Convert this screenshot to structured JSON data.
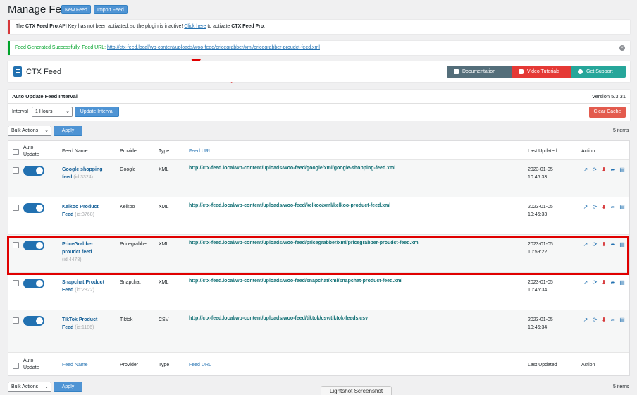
{
  "page": {
    "title": "Manage Feed",
    "new_feed": "New Feed",
    "import_feed": "Import Feed"
  },
  "notice_error": {
    "pre": "The ",
    "bold1": "CTX Feed Pro",
    "mid": " API Key has not been activated, so the plugin is inactive! ",
    "link": "Click here",
    "post": " to activate ",
    "bold2": "CTX Feed Pro",
    "end": "."
  },
  "notice_success": {
    "text": "Feed Generated Successfully. Feed URL: ",
    "url": "http://ctx-feed.local/wp-content/uploads/woo-feed/pricegrabber/xml/pricegrabber-proudct-feed.xml",
    "close": "×"
  },
  "header": {
    "app_title": "CTX Feed",
    "documentation": "Documentation",
    "video": "Video Tutorials",
    "support": "Get Support",
    "colors": {
      "documentation": "#546e7a",
      "video": "#e53935",
      "support": "#26a69a"
    }
  },
  "interval_panel": {
    "title": "Auto Update Feed Interval",
    "version": "Version 5.3.31",
    "interval_label": "Interval",
    "interval_value": "1 Hours",
    "update_button": "Update Interval",
    "clear_cache": "Clear Cache"
  },
  "bulk": {
    "label": "Bulk Actions",
    "apply": "Apply",
    "count": "5 items"
  },
  "columns": {
    "auto_update_1": "Auto",
    "auto_update_2": "Update",
    "feed_name": "Feed Name",
    "provider": "Provider",
    "type": "Type",
    "feed_url": "Feed URL",
    "last_updated": "Last Updated",
    "action": "Action"
  },
  "rows": [
    {
      "name1": "Google shopping",
      "name2": "feed",
      "id": "(id:3324)",
      "provider": "Google",
      "type": "XML",
      "url": "http://ctx-feed.local/wp-content/uploads/woo-feed/google/xml/google-shopping-feed.xml",
      "date": "2023-01-05",
      "time": "10:46:33",
      "auto_update": true
    },
    {
      "name1": "Kelkoo Product",
      "name2": "Feed",
      "id": "(id:3768)",
      "provider": "Kelkoo",
      "type": "XML",
      "url": "http://ctx-feed.local/wp-content/uploads/woo-feed/kelkoo/xml/kelkoo-product-feed.xml",
      "date": "2023-01-05",
      "time": "10:46:33",
      "auto_update": true
    },
    {
      "name1": "PriceGrabber",
      "name2": "proudct feed",
      "id": "(id:4478)",
      "provider": "Pricegrabber",
      "type": "XML",
      "url": "http://ctx-feed.local/wp-content/uploads/woo-feed/pricegrabber/xml/pricegrabber-proudct-feed.xml",
      "date": "2023-01-05",
      "time": "10:59:22",
      "auto_update": true
    },
    {
      "name1": "Snapchat Product",
      "name2": "Feed",
      "id": "(id:2822)",
      "provider": "Snapchat",
      "type": "XML",
      "url": "http://ctx-feed.local/wp-content/uploads/woo-feed/snapchat/xml/snapchat-product-feed.xml",
      "date": "2023-01-05",
      "time": "10:46:34",
      "auto_update": true
    },
    {
      "name1": "TikTok Product",
      "name2": "Feed",
      "id": "(id:1186)",
      "provider": "Tiktok",
      "type": "CSV",
      "url": "http://ctx-feed.local/wp-content/uploads/woo-feed/tiktok/csv/tiktok-feeds.csv",
      "date": "2023-01-05",
      "time": "10:46:34",
      "auto_update": true
    }
  ],
  "overlay": {
    "lightshot": "Lightshot Screenshot"
  }
}
